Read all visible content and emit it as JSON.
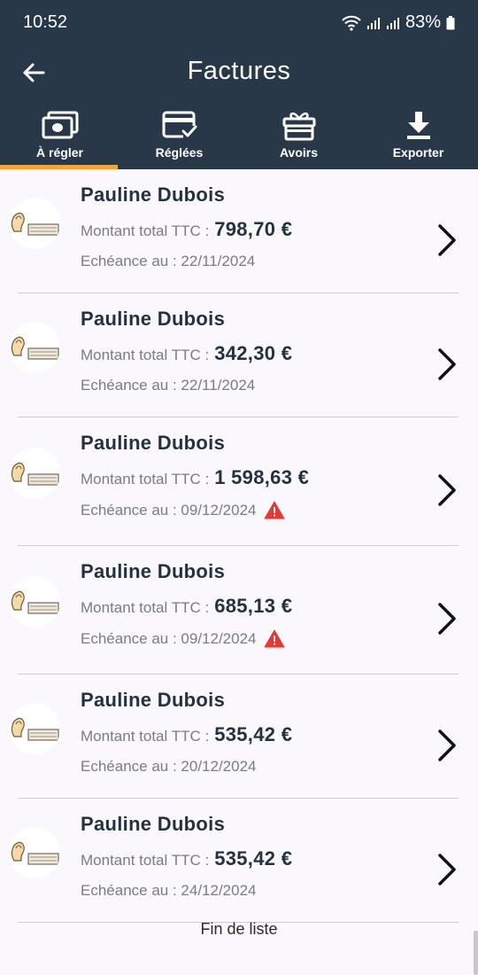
{
  "status": {
    "time": "10:52",
    "battery": "83%"
  },
  "header": {
    "title": "Factures"
  },
  "tabs": [
    {
      "label": "À régler",
      "icon": "cash-icon",
      "active": true
    },
    {
      "label": "Réglées",
      "icon": "card-check-icon",
      "active": false
    },
    {
      "label": "Avoirs",
      "icon": "gift-icon",
      "active": false
    },
    {
      "label": "Exporter",
      "icon": "download-icon",
      "active": false
    }
  ],
  "invoices": [
    {
      "name": "Pauline Dubois",
      "amount_label": "Montant total TTC :",
      "amount": "798,70 €",
      "due_label": "Echéance au : 22/11/2024",
      "overdue": false
    },
    {
      "name": "Pauline Dubois",
      "amount_label": "Montant total TTC :",
      "amount": "342,30 €",
      "due_label": "Echéance au : 22/11/2024",
      "overdue": false
    },
    {
      "name": "Pauline Dubois",
      "amount_label": "Montant total TTC :",
      "amount": "1 598,63 €",
      "due_label": "Echéance au : 09/12/2024",
      "overdue": true
    },
    {
      "name": "Pauline Dubois",
      "amount_label": "Montant total TTC :",
      "amount": "685,13 €",
      "due_label": "Echéance au : 09/12/2024",
      "overdue": true
    },
    {
      "name": "Pauline Dubois",
      "amount_label": "Montant total TTC :",
      "amount": "535,42 €",
      "due_label": "Echéance au : 20/12/2024",
      "overdue": false
    },
    {
      "name": "Pauline Dubois",
      "amount_label": "Montant total TTC :",
      "amount": "535,42 €",
      "due_label": "Echéance au : 24/12/2024",
      "overdue": false
    }
  ],
  "footer": {
    "end_label": "Fin de liste"
  },
  "colors": {
    "header_bg": "#283848",
    "tab_indicator": "#f2a33a",
    "warning": "#e53935",
    "text_dark": "#243240"
  }
}
